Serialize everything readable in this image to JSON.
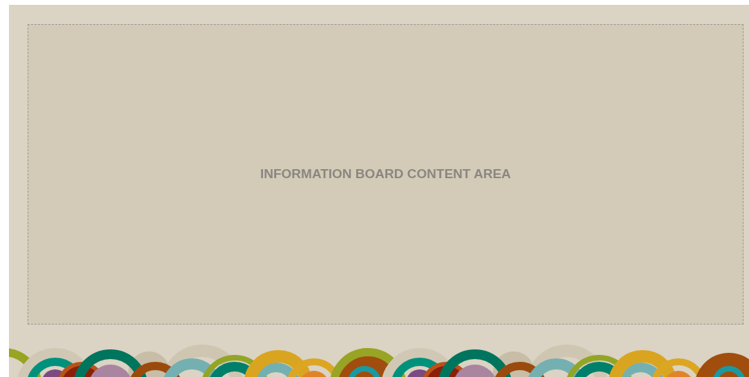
{
  "board": {
    "content_label": "INFORMATION BOARD CONTENT AREA"
  }
}
